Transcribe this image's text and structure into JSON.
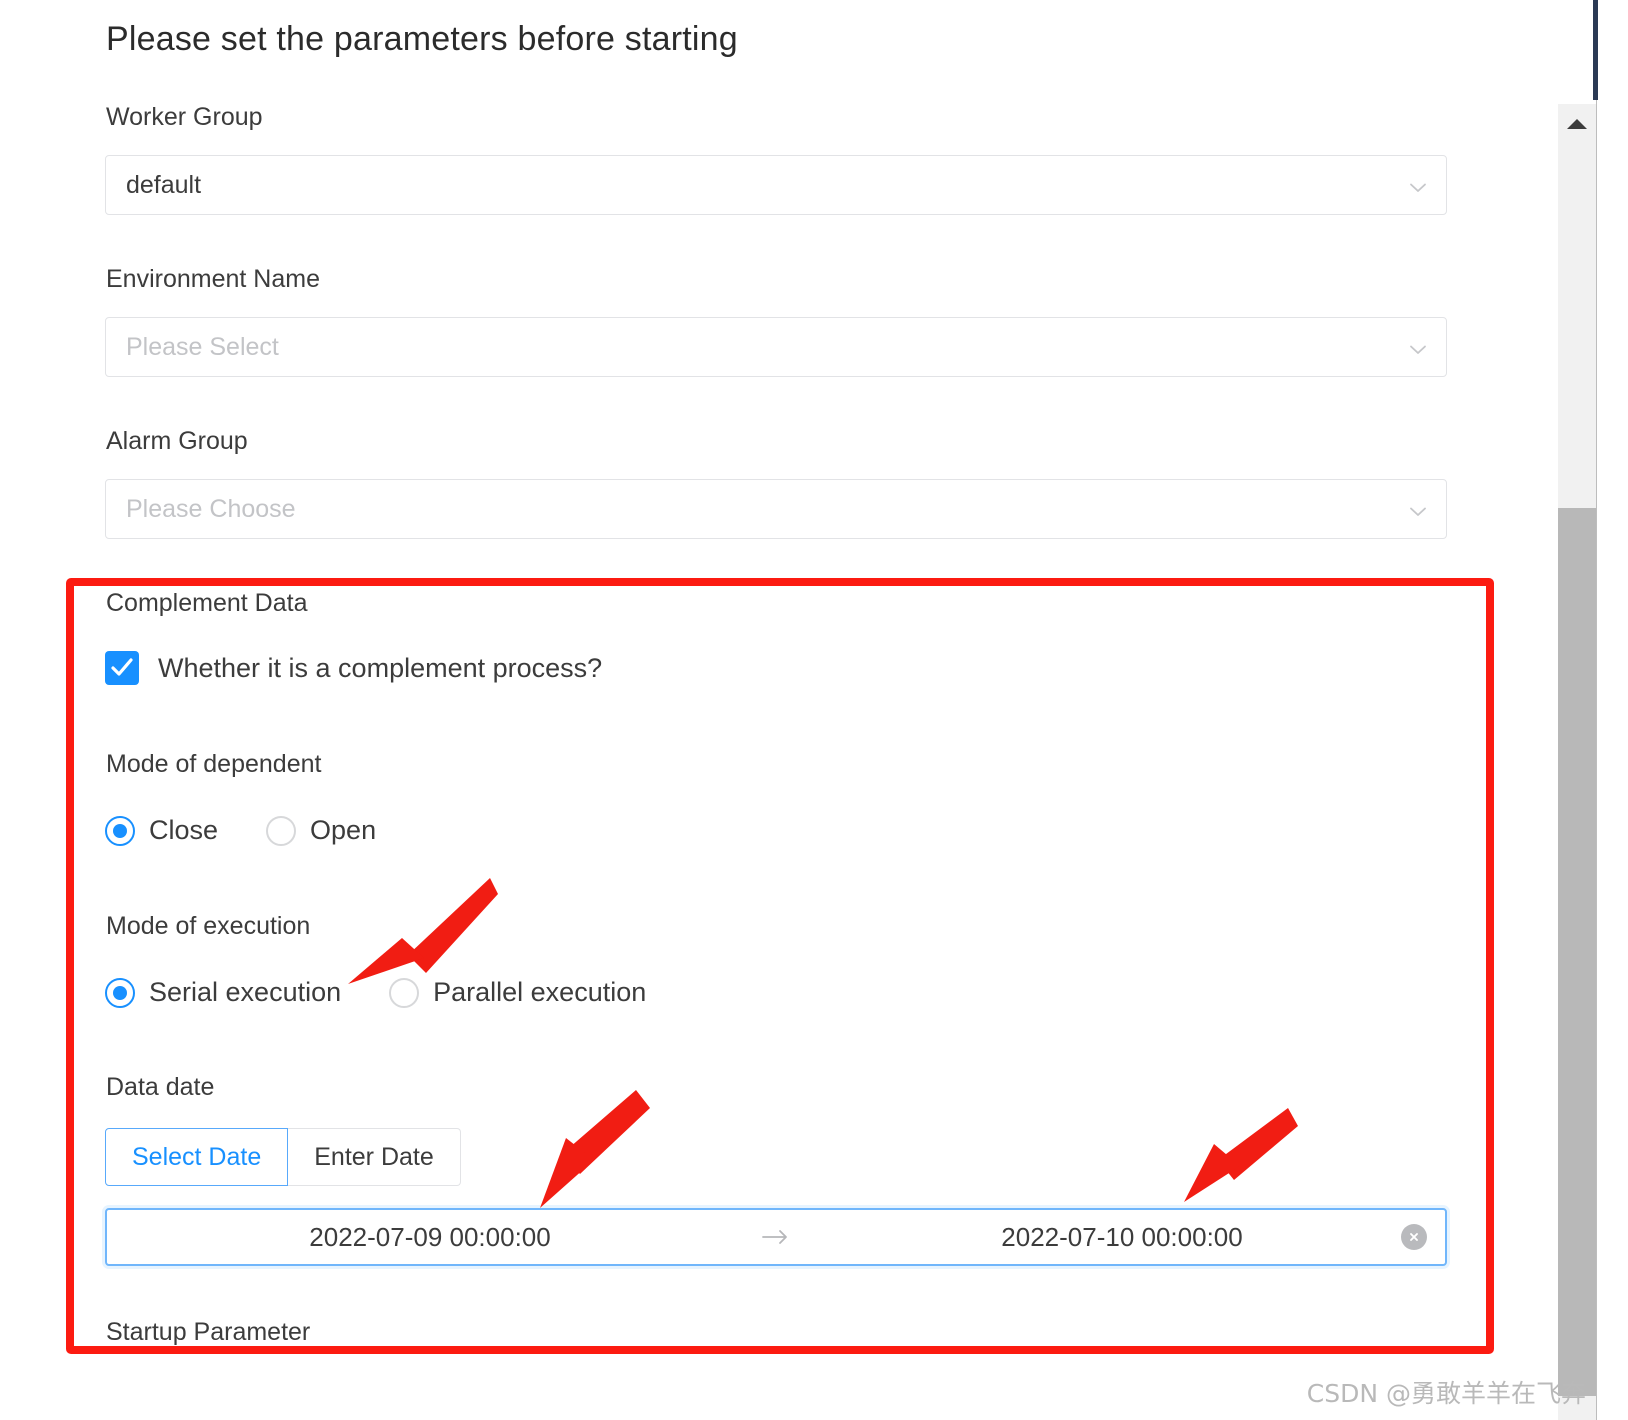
{
  "dialog": {
    "title": "Please set the parameters before starting"
  },
  "fields": {
    "worker_group": {
      "label": "Worker Group",
      "value": "default",
      "icon": "chevron-down-icon"
    },
    "environment_name": {
      "label": "Environment Name",
      "value": "",
      "placeholder": "Please Select",
      "icon": "chevron-down-icon"
    },
    "alarm_group": {
      "label": "Alarm Group",
      "value": "",
      "placeholder": "Please Choose",
      "icon": "chevron-down-icon"
    }
  },
  "complement": {
    "section_label": "Complement Data",
    "checkbox": {
      "label": "Whether it is a complement process?",
      "checked": true
    },
    "mode_of_dependent": {
      "label": "Mode of dependent",
      "options": [
        {
          "label": "Close",
          "checked": true
        },
        {
          "label": "Open",
          "checked": false
        }
      ]
    },
    "mode_of_execution": {
      "label": "Mode of execution",
      "options": [
        {
          "label": "Serial execution",
          "checked": true
        },
        {
          "label": "Parallel execution",
          "checked": false
        }
      ]
    },
    "data_date": {
      "label": "Data date",
      "tabs": [
        {
          "label": "Select Date",
          "active": true
        },
        {
          "label": "Enter Date",
          "active": false
        }
      ],
      "range": {
        "start": "2022-07-09 00:00:00",
        "end": "2022-07-10 00:00:00",
        "separator_icon": "arrow-right-icon",
        "clear_icon": "clear-circle-icon"
      }
    }
  },
  "startup_parameter": {
    "label": "Startup Parameter"
  },
  "annotations": {
    "highlight_color": "#fc1b11",
    "arrow_color": "#f11d13",
    "arrow_count": 3
  },
  "scrollbar": {
    "up_arrow_icon": "scroll-up-arrow-icon"
  },
  "watermark": {
    "text": "CSDN @勇敢羊羊在飞奔"
  },
  "colors": {
    "accent": "#1890ff",
    "annotation": "#fc1b11",
    "text": "#3c3c3c",
    "placeholder": "#c3c4c7",
    "border": "#e2e3e6"
  }
}
